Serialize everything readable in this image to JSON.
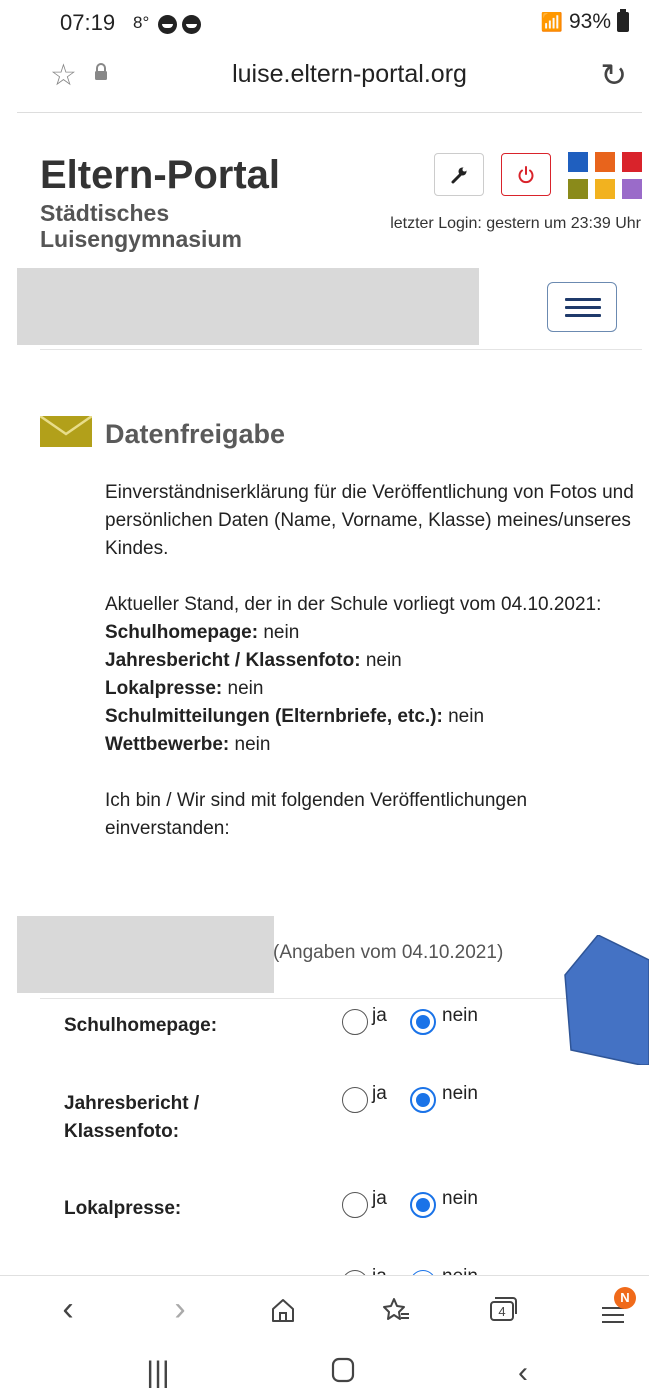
{
  "status": {
    "time": "07:19",
    "temp": "8°",
    "battery": "93%"
  },
  "browser": {
    "url": "luise.eltern-portal.org"
  },
  "header": {
    "title": "Eltern-Portal",
    "school_line1": "Städtisches",
    "school_line2": "Luisengymnasium",
    "last_login": "letzter Login: gestern um 23:39 Uhr",
    "tile_colors": [
      "#1f5fbf",
      "#e8641c",
      "#d9232b",
      "#8a8a1a",
      "#f2b21f",
      "#9a6bc9"
    ]
  },
  "section": {
    "title": "Datenfreigabe",
    "intro": "Einverständniserklärung für die Veröffentlichung von Fotos und persönlichen Daten (Name, Vorname, Klasse) meines/unseres Kindes.",
    "stand_text": "Aktueller Stand, der in der Schule vorliegt vom 04.10.2021:",
    "items": [
      {
        "label": "Schulhomepage:",
        "value": "nein"
      },
      {
        "label": "Jahresbericht / Klassenfoto:",
        "value": "nein"
      },
      {
        "label": "Lokalpresse:",
        "value": "nein"
      },
      {
        "label": "Schulmitteilungen (Elternbriefe, etc.):",
        "value": "nein"
      },
      {
        "label": "Wettbewerbe:",
        "value": "nein"
      }
    ],
    "consent_text": "Ich bin / Wir sind mit folgenden Veröffentlichungen einverstanden:",
    "angaben": "(Angaben vom 04.10.2021)"
  },
  "form": {
    "rows": [
      {
        "label": "Schulhomepage:",
        "yes": "ja",
        "no": "nein"
      },
      {
        "label": "Jahresbericht / Klassenfoto:",
        "yes": "ja",
        "no": "nein"
      },
      {
        "label": "Lokalpresse:",
        "yes": "ja",
        "no": "nein"
      },
      {
        "label": "",
        "yes": "ja",
        "no": "nein"
      }
    ]
  },
  "nav": {
    "tabs_count": "4",
    "badge": "N"
  }
}
